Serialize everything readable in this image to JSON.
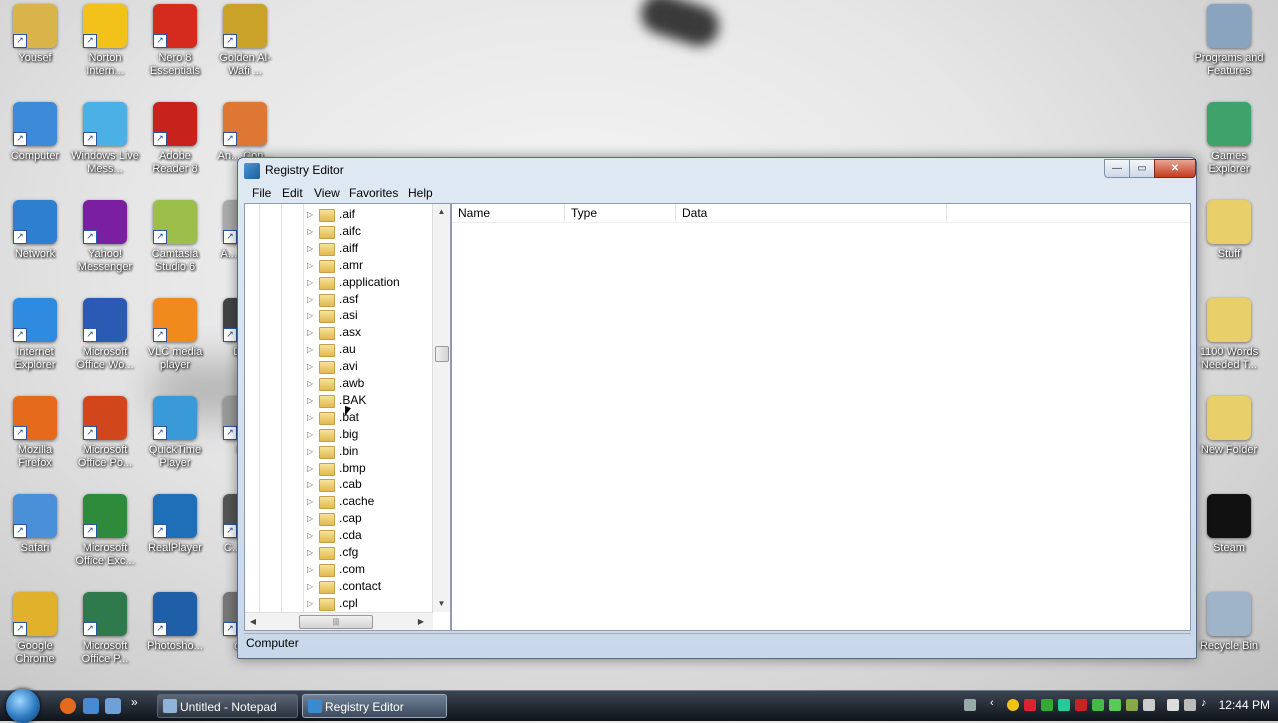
{
  "desktop": {
    "icons_left": [
      {
        "label": "Yousef",
        "color": "#d9b44a",
        "icon": "folder-icon"
      },
      {
        "label": "Norton Intern...",
        "color": "#f2c21b",
        "icon": "norton-globe-icon"
      },
      {
        "label": "Nero 8 Essentials",
        "color": "#d52b1e",
        "icon": "nero-icon"
      },
      {
        "label": "Golden Al-Wafi ...",
        "color": "#c9a227",
        "icon": "golden-icon"
      },
      {
        "label": "Computer",
        "color": "#3c8ad8",
        "icon": "computer-icon"
      },
      {
        "label": "Windows Live Mess...",
        "color": "#4ab0e6",
        "icon": "messenger-icon"
      },
      {
        "label": "Adobe Reader 8",
        "color": "#c7231c",
        "icon": "adobe-reader-icon"
      },
      {
        "label": "An... Con...",
        "color": "#d73",
        "icon": "converter-icon"
      },
      {
        "label": "Network",
        "color": "#2f7fd0",
        "icon": "network-icon"
      },
      {
        "label": "Yahoo! Messenger",
        "color": "#7b1fa2",
        "icon": "yahoo-icon"
      },
      {
        "label": "Camtasia Studio 6",
        "color": "#9bbf4a",
        "icon": "camtasia-icon"
      },
      {
        "label": "A... Con...",
        "color": "#aaa",
        "icon": "app-icon"
      },
      {
        "label": "Internet Explorer",
        "color": "#2e8be0",
        "icon": "ie-icon"
      },
      {
        "label": "Microsoft Office Wo...",
        "color": "#2a5ab3",
        "icon": "word-icon"
      },
      {
        "label": "VLC media player",
        "color": "#f08a1c",
        "icon": "vlc-icon"
      },
      {
        "label": "DV...",
        "color": "#444",
        "icon": "dvd-icon"
      },
      {
        "label": "Mozilla Firefox",
        "color": "#e66a1c",
        "icon": "firefox-icon"
      },
      {
        "label": "Microsoft Office Po...",
        "color": "#d2461c",
        "icon": "powerpoint-icon"
      },
      {
        "label": "QuickTime Player",
        "color": "#3a9ad8",
        "icon": "quicktime-icon"
      },
      {
        "label": "D...",
        "color": "#999",
        "icon": "app-icon"
      },
      {
        "label": "Safari",
        "color": "#4a90d9",
        "icon": "safari-icon"
      },
      {
        "label": "Microsoft Office Exc...",
        "color": "#2e8b3c",
        "icon": "excel-icon"
      },
      {
        "label": "RealPlayer",
        "color": "#1e6fb8",
        "icon": "realplayer-icon"
      },
      {
        "label": "C... Wi...",
        "color": "#555",
        "icon": "app-icon"
      },
      {
        "label": "Google Chrome",
        "color": "#e2b12c",
        "icon": "chrome-icon"
      },
      {
        "label": "Microsoft Office P...",
        "color": "#2e7a4c",
        "icon": "publisher-icon"
      },
      {
        "label": "Photosho...",
        "color": "#1e5fa8",
        "icon": "photoshop-icon"
      },
      {
        "label": "do...",
        "color": "#777",
        "icon": "app-icon"
      }
    ],
    "icons_right": [
      {
        "label": "Programs and Features",
        "color": "#8aa4c0",
        "icon": "programs-icon"
      },
      {
        "label": "Games Explorer",
        "color": "#3fa26a",
        "icon": "games-icon"
      },
      {
        "label": "Stuff",
        "color": "#e8cf6a",
        "icon": "folder-icon"
      },
      {
        "label": "1100 Words Needed T...",
        "color": "#e8cf6a",
        "icon": "folder-icon"
      },
      {
        "label": "New Folder",
        "color": "#e8cf6a",
        "icon": "folder-icon"
      },
      {
        "label": "Steam",
        "color": "#111111",
        "icon": "steam-icon"
      },
      {
        "label": "Recycle Bin",
        "color": "#9fb4c8",
        "icon": "recycle-bin-icon"
      }
    ]
  },
  "window": {
    "title": "Registry Editor",
    "menu": [
      "File",
      "Edit",
      "View",
      "Favorites",
      "Help"
    ],
    "tree_items": [
      ".aif",
      ".aifc",
      ".aiff",
      ".amr",
      ".application",
      ".asf",
      ".asi",
      ".asx",
      ".au",
      ".avi",
      ".awb",
      ".BAK",
      ".bat",
      ".big",
      ".bin",
      ".bmp",
      ".cab",
      ".cache",
      ".cap",
      ".cda",
      ".cfg",
      ".com",
      ".contact",
      ".cpl"
    ],
    "columns": [
      "Name",
      "Type",
      "Data"
    ],
    "status": "Computer",
    "controls": {
      "minimize": "—",
      "maximize": "▭",
      "close": "✕"
    }
  },
  "taskbar": {
    "buttons": [
      "Untitled - Notepad",
      "Registry Editor"
    ],
    "clock": "12:44 PM",
    "overflow": "»"
  }
}
